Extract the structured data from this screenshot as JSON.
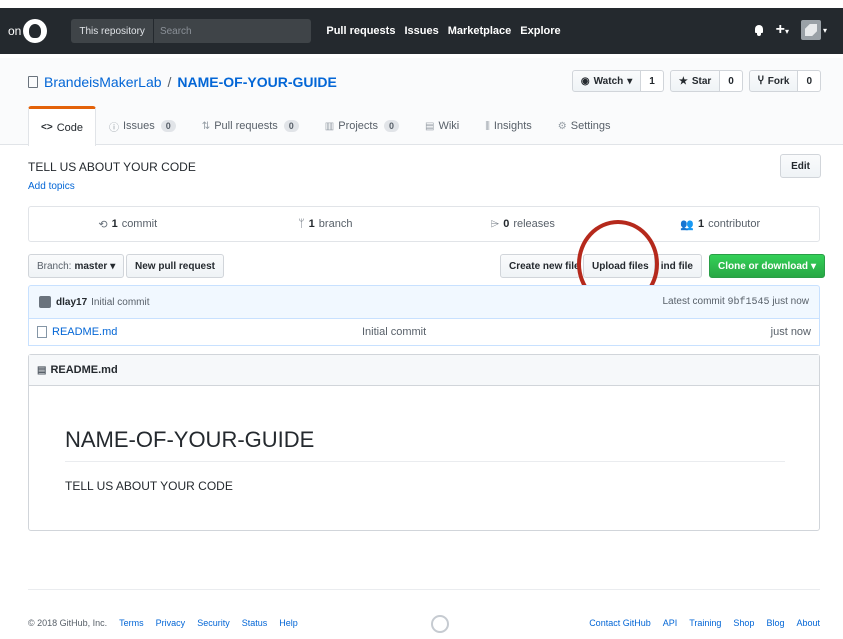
{
  "topnav": {
    "cut_text": "on",
    "search_scope": "This repository",
    "search_placeholder": "Search",
    "links": [
      "Pull requests",
      "Issues",
      "Marketplace",
      "Explore"
    ]
  },
  "repo": {
    "owner": "BrandeisMakerLab",
    "separator": "/",
    "name": "NAME-OF-YOUR-GUIDE",
    "watch_label": "Watch",
    "watch_count": "1",
    "star_label": "Star",
    "star_count": "0",
    "fork_label": "Fork",
    "fork_count": "0"
  },
  "tabs": [
    {
      "label": "Code",
      "icon": "<>"
    },
    {
      "label": "Issues",
      "count": "0",
      "icon": "ⓘ"
    },
    {
      "label": "Pull requests",
      "count": "0",
      "icon": "⇅"
    },
    {
      "label": "Projects",
      "count": "0",
      "icon": "▥"
    },
    {
      "label": "Wiki",
      "icon": "▤"
    },
    {
      "label": "Insights",
      "icon": "⫼"
    },
    {
      "label": "Settings",
      "icon": "⚙"
    }
  ],
  "description": {
    "text": "TELL US ABOUT YOUR CODE",
    "add_topics": "Add topics",
    "edit_label": "Edit"
  },
  "numbers": {
    "commits_n": "1",
    "commits_label": "commit",
    "branches_n": "1",
    "branches_label": "branch",
    "releases_n": "0",
    "releases_label": "releases",
    "contributors_n": "1",
    "contributors_label": "contributor"
  },
  "file_nav": {
    "branch_prefix": "Branch:",
    "branch_name": "master",
    "new_pr": "New pull request",
    "create_file": "Create new file",
    "upload_files": "Upload files",
    "find_file": "ind file",
    "clone_download": "Clone or download"
  },
  "commit": {
    "author": "dlay17",
    "message": "Initial commit",
    "latest_label": "Latest commit",
    "sha": "9bf1545",
    "age": "just now"
  },
  "files": [
    {
      "name": "README.md",
      "message": "Initial commit",
      "age": "just now"
    }
  ],
  "readme": {
    "header": "README.md",
    "h1": "NAME-OF-YOUR-GUIDE",
    "p": "TELL US ABOUT YOUR CODE"
  },
  "footer": {
    "copyright": "© 2018 GitHub, Inc.",
    "left_links": [
      "Terms",
      "Privacy",
      "Security",
      "Status",
      "Help"
    ],
    "right_links": [
      "Contact GitHub",
      "API",
      "Training",
      "Shop",
      "Blog",
      "About"
    ]
  },
  "colors": {
    "highlight_circle": "#b5291c",
    "nav_bg": "#24292e",
    "link": "#0366d6",
    "selected_tab_accent": "#e36209",
    "clone_button": "#28a745"
  }
}
